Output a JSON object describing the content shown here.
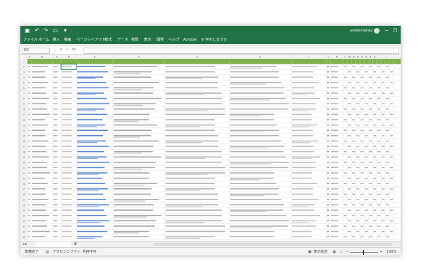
{
  "window": {
    "user": "asokentansu",
    "minimize": "─",
    "restore": "❐",
    "close": "✕",
    "save_icon": "save-icon",
    "undo": "↶",
    "redo": "↷",
    "touch": "▭"
  },
  "tabs": [
    "ファイル",
    "ホーム",
    "挿入",
    "描画",
    "ページレイアウト",
    "数式",
    "データ",
    "校閲",
    "表示",
    "開発",
    "ヘルプ",
    "Acrobat",
    "♀ 何をしますか"
  ],
  "formula_bar": {
    "name_box": "D2",
    "cancel": "×",
    "enter": "✓",
    "fx": "fx"
  },
  "columns": [
    "A",
    "B",
    "C",
    "D",
    "E",
    "F",
    "G",
    "H",
    "I",
    "J",
    "K",
    "L",
    "M",
    "N",
    "O",
    "P",
    "Q",
    "R",
    "S"
  ],
  "sheet_tab": "",
  "status": {
    "ready": "準備完了",
    "accessibility": "アクセシビリティ: 利用不可",
    "display_settings": "表示設定",
    "zoom": "100%",
    "minus": "−",
    "plus": "+"
  },
  "colors": {
    "accent": "#217346",
    "header_row": "#7fb24a",
    "link": "#1f5fbf"
  }
}
